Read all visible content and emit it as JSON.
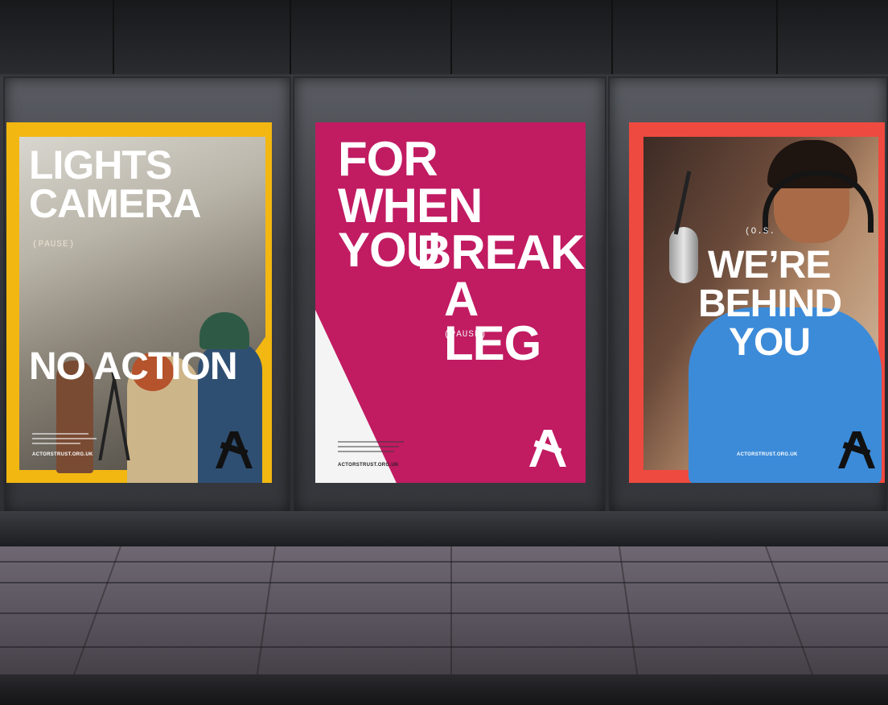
{
  "posters": [
    {
      "headline_top_1": "LIGHTS",
      "headline_top_2": "CAMERA",
      "pause": "(PAUSE)",
      "headline_bottom": "NO ACTION",
      "url": "ACTORSTRUST.ORG.UK",
      "logo_text": "ACTORS TRUST",
      "accent": "#f3b711"
    },
    {
      "headline_1": "FOR",
      "headline_2": "WHEN YOU",
      "headline_3": "BREAK",
      "headline_4": "A LEG",
      "pause": "(PAUSE)",
      "url": "ACTORSTRUST.ORG.UK",
      "logo_text": "ACTORS TRUST",
      "accent": "#c11b62"
    },
    {
      "small_label": "(O.S.",
      "headline_1": "WE’RE",
      "headline_2": "BEHIND",
      "headline_3": "YOU",
      "url": "ACTORSTRUST.ORG.UK",
      "logo_text": "ACTORS TRUST",
      "accent": "#ee4a3f"
    }
  ]
}
